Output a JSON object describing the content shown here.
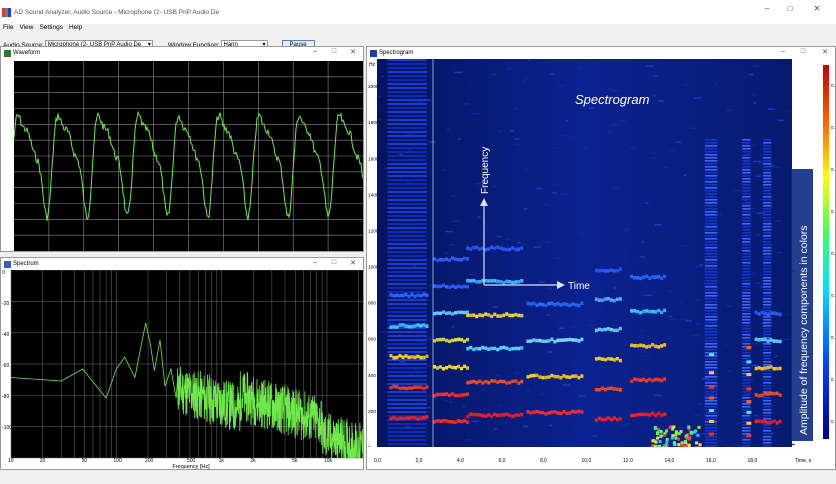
{
  "window": {
    "title": "AD Sound Analyzer, Audio Source - Microphone (2- USB PnP Audio De",
    "minimize": "–",
    "maximize": "□",
    "close": "✕"
  },
  "menu": [
    "File",
    "View",
    "Settings",
    "Help"
  ],
  "toolbar": {
    "audio_source_label": "Audio Source:",
    "audio_source_value": "Microphone (2- USB PnP Audio De",
    "window_function_label": "Window Function:",
    "window_function_value": "Hann",
    "pause_label": "Pause"
  },
  "waveform": {
    "title": "Waveform"
  },
  "spectrum": {
    "title": "Spectrum",
    "y_ticks": [
      "0",
      "-20",
      "-40",
      "-60",
      "-80",
      "-100"
    ],
    "x_ticks": [
      "10",
      "20",
      "50",
      "100",
      "200",
      "500",
      "1k",
      "2k",
      "5k",
      "10k"
    ],
    "x_label": "Frequency [Hz]"
  },
  "spectrogram": {
    "title": "Spectrogram",
    "y_unit": "Hz",
    "y_ticks": [
      "2000",
      "1800",
      "1600",
      "1400",
      "1200",
      "1000",
      "800",
      "600",
      "400",
      "200",
      "0"
    ],
    "x_ticks": [
      "0,0",
      "2,0",
      "4,0",
      "6,0",
      "8,0",
      "10,0",
      "12,0",
      "14,0",
      "16,0",
      "18,0"
    ],
    "x_label": "Time, s",
    "colorbar_ticks": [
      "0,8",
      "0,7",
      "0,6",
      "0,5",
      "0,4",
      "0,3",
      "0,2",
      "0,1",
      "0,0"
    ],
    "annotation_title": "Spectrogram",
    "annotation_frequency": "Frequency",
    "annotation_time": "Time",
    "annotation_amplitude": "Amplitude of  frequency components in colors"
  },
  "colors": {
    "trace": "#6fe84a",
    "spectro_bg": "#061a78",
    "grid": "#9a9a9a"
  }
}
